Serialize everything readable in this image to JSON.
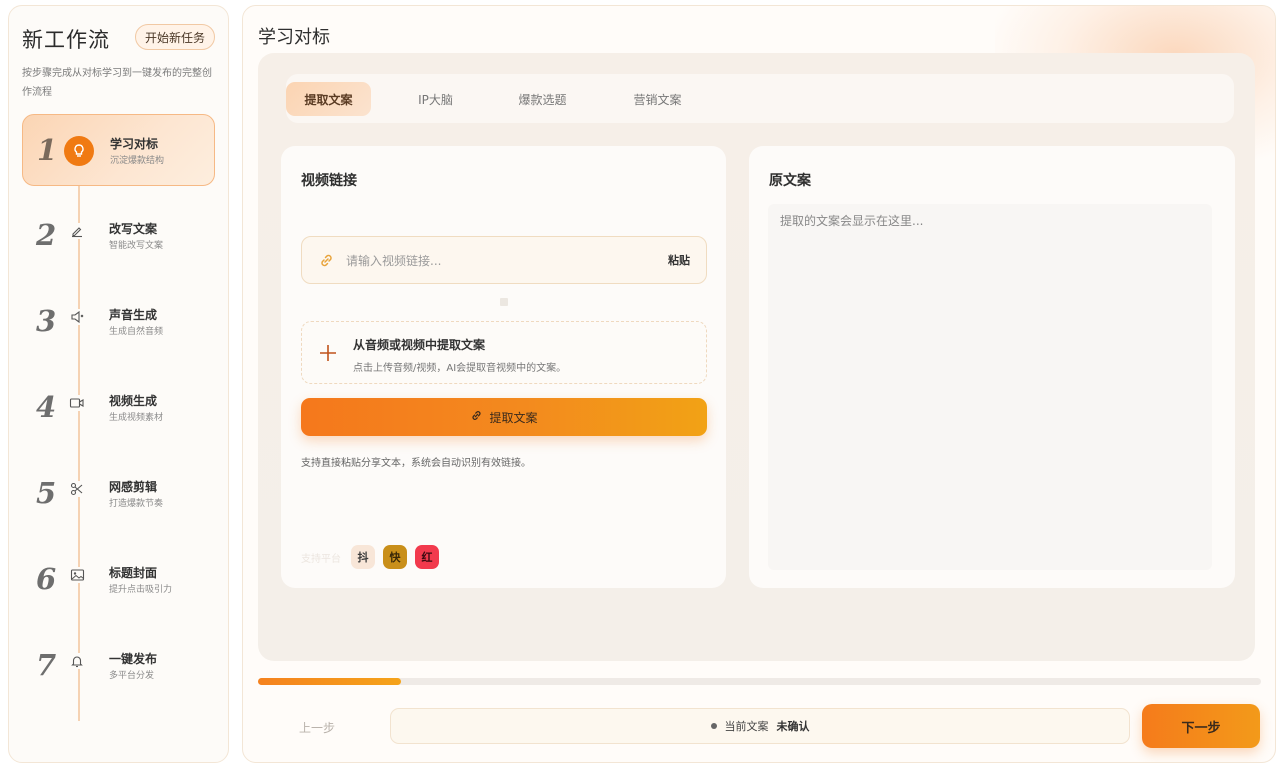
{
  "sidebar": {
    "title": "新工作流",
    "new_task": "开始新任务",
    "description": "按步骤完成从对标学习到一键发布的完整创作流程",
    "steps": [
      {
        "num": "1",
        "label": "学习对标",
        "sub": "沉淀爆款结构",
        "icon": "lightbulb-icon",
        "active": true
      },
      {
        "num": "2",
        "label": "改写文案",
        "sub": "智能改写文案",
        "icon": "pencil-icon"
      },
      {
        "num": "3",
        "label": "声音生成",
        "sub": "生成自然音频",
        "icon": "speaker-icon"
      },
      {
        "num": "4",
        "label": "视频生成",
        "sub": "生成视频素材",
        "icon": "video-camera-icon"
      },
      {
        "num": "5",
        "label": "网感剪辑",
        "sub": "打造爆款节奏",
        "icon": "scissors-icon"
      },
      {
        "num": "6",
        "label": "标题封面",
        "sub": "提升点击吸引力",
        "icon": "image-icon"
      },
      {
        "num": "7",
        "label": "一键发布",
        "sub": "多平台分发",
        "icon": "bell-icon"
      }
    ]
  },
  "main": {
    "title": "学习对标",
    "tabs": [
      {
        "label": "提取文案",
        "active": true
      },
      {
        "label": "IP大脑"
      },
      {
        "label": "爆款选题"
      },
      {
        "label": "营销文案"
      }
    ]
  },
  "left_card": {
    "title": "视频链接",
    "input_placeholder": "请输入视频链接...",
    "input_value": "",
    "paste_label": "粘贴",
    "upload_title": "从音频或视频中提取文案",
    "upload_desc": "点击上传音频/视频，AI会提取音视频中的文案。",
    "extract_label": "提取文案",
    "hint": "支持直接粘贴分享文本，系统会自动识别有效链接。",
    "platforms_label": "支持平台",
    "platforms": [
      "抖",
      "快",
      "红"
    ]
  },
  "right_card": {
    "title": "原文案",
    "placeholder": "提取的文案会显示在这里..."
  },
  "footer": {
    "progress": 0.143,
    "prev_label": "上一步",
    "status_label": "当前文案",
    "status_value": "未确认",
    "next_label": "下一步"
  },
  "colors": {
    "accent": "#f5781c",
    "accent_light": "#fbd5b4",
    "background": "#fffcf9"
  }
}
